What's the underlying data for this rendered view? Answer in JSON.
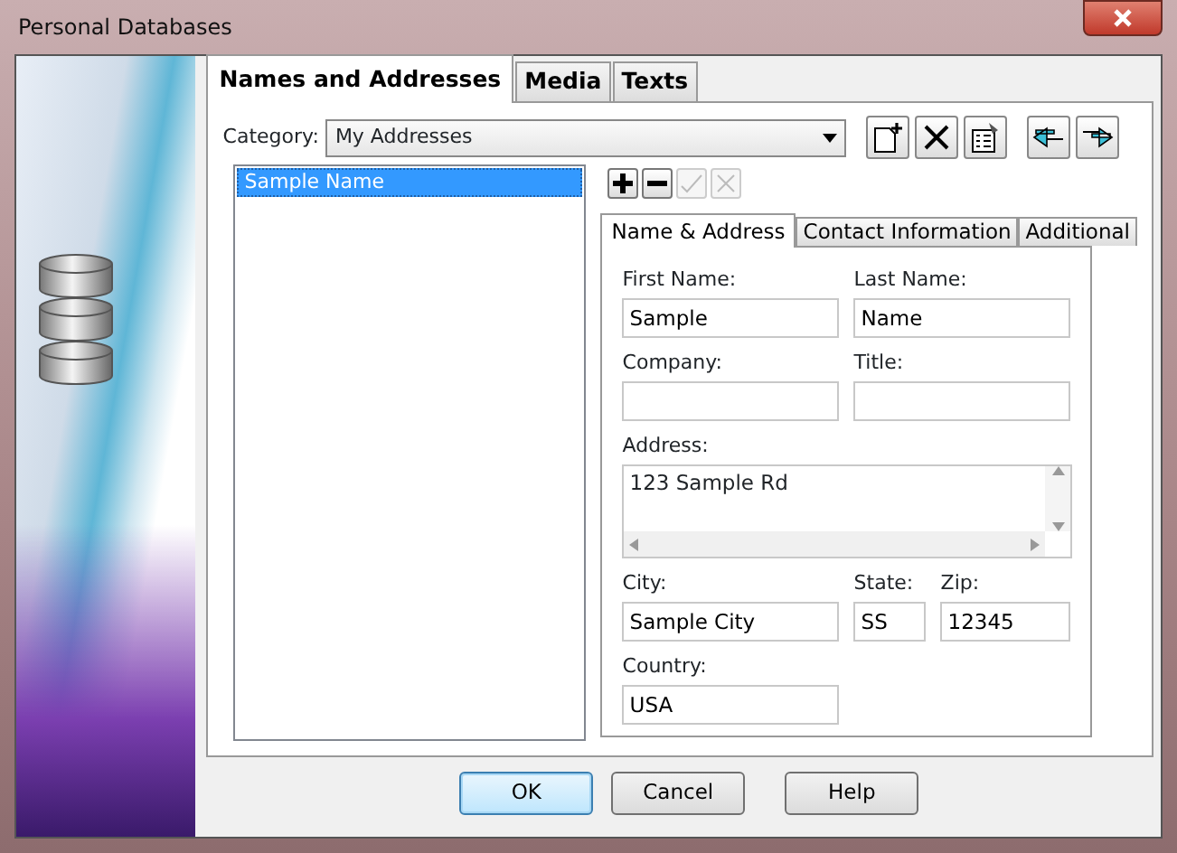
{
  "window": {
    "title": "Personal Databases"
  },
  "tabs": [
    {
      "label": "Names and Addresses",
      "selected": true
    },
    {
      "label": "Media",
      "selected": false
    },
    {
      "label": "Texts",
      "selected": false
    }
  ],
  "category": {
    "label": "Category:",
    "value": "My Addresses"
  },
  "records": [
    {
      "label": "Sample Name",
      "selected": true
    }
  ],
  "record_tools": [
    {
      "kind": "add",
      "disabled": false
    },
    {
      "kind": "remove",
      "disabled": false
    },
    {
      "kind": "edit",
      "disabled": true
    },
    {
      "kind": "cancel",
      "disabled": true
    }
  ],
  "detail_tabs": [
    {
      "label": "Name & Address",
      "selected": true
    },
    {
      "label": "Contact Information",
      "selected": false
    },
    {
      "label": "Additional",
      "selected": false
    }
  ],
  "field_rows": [
    [
      {
        "label": "First Name:",
        "value": "Sample"
      },
      {
        "label": "Last Name:",
        "value": "Name"
      }
    ],
    [
      {
        "label": "Company:"
      },
      {
        "label": "Title:"
      }
    ]
  ],
  "address": {
    "label": "Address:",
    "value": "123 Sample Rd"
  },
  "field_rows_2": [
    [
      {
        "label": "City:",
        "value": "Sample City"
      },
      {
        "label": "State:",
        "value": "SS"
      },
      {
        "label": "Zip:",
        "value": "12345"
      }
    ],
    [
      {
        "label": "Country:",
        "value": "USA"
      }
    ]
  ],
  "buttons": [
    {
      "label": "OK",
      "default": true
    },
    {
      "label": "Cancel",
      "default": false
    },
    {
      "label": "Help",
      "default": false
    }
  ]
}
